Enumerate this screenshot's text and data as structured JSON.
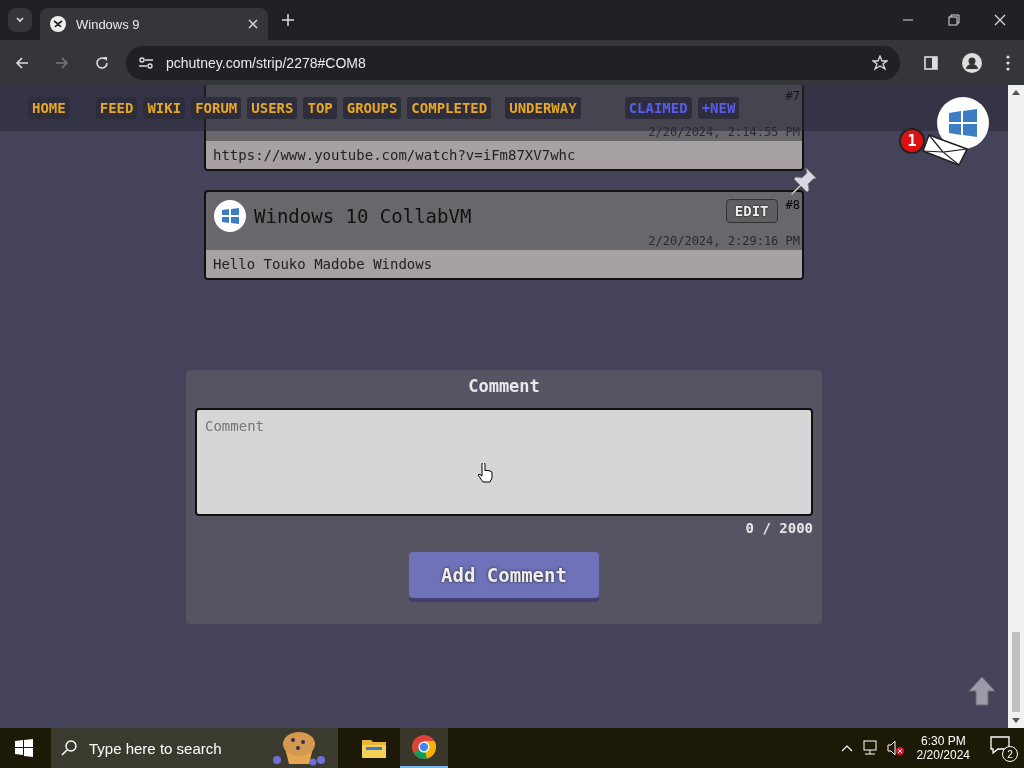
{
  "browser": {
    "tabs": [
      {
        "title": "Windows 9",
        "selected": true
      }
    ],
    "address": "pchutney.com/strip/2278#COM8"
  },
  "nav": {
    "items": [
      {
        "label": "HOME",
        "color": "#e8a826"
      },
      {
        "label": "FEED",
        "color": "#e8a826"
      },
      {
        "label": "WIKI",
        "color": "#e8a826"
      },
      {
        "label": "FORUM",
        "color": "#e8a826"
      },
      {
        "label": "USERS",
        "color": "#e8a826"
      },
      {
        "label": "TOP",
        "color": "#e8a826"
      },
      {
        "label": "GROUPS",
        "color": "#e8a826"
      },
      {
        "label": "COMPLETED",
        "color": "#e8a826"
      },
      {
        "label": "UNDERWAY",
        "color": "#e8a826"
      },
      {
        "label": "CLAIMED",
        "color": "#5a5cf0"
      },
      {
        "label": "+NEW",
        "color": "#5a5cf0"
      }
    ]
  },
  "notifications": {
    "count": "1"
  },
  "comments": [
    {
      "number": "#7",
      "timestamp": "2/20/2024, 2:14:55 PM",
      "body": "https://www.youtube.com/watch?v=iFm87XV7whc"
    },
    {
      "number": "#8",
      "author": "Windows 10 CollabVM",
      "edit": "EDIT",
      "timestamp": "2/20/2024, 2:29:16 PM",
      "body": "Hello Touko Madobe Windows",
      "pinned": true
    }
  ],
  "form": {
    "title": "Comment",
    "placeholder": "Comment",
    "counter": "0 / 2000",
    "button": "Add Comment"
  },
  "taskbar": {
    "search_placeholder": "Type here to search",
    "time": "6:30 PM",
    "date": "2/20/2024",
    "notification_count": "2"
  }
}
